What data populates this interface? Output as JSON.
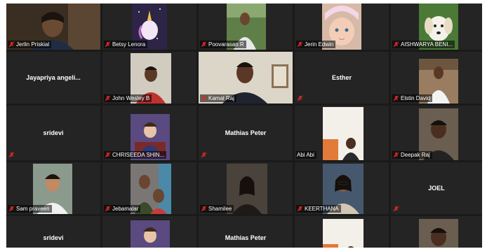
{
  "participants": [
    {
      "name": "Jerlin Priskial",
      "video": true,
      "bg": "#3d3226"
    },
    {
      "name": "Betsy Lenora",
      "video": true,
      "bg": "#2c2546"
    },
    {
      "name": "Poovarasan R",
      "video": true,
      "bg": "#4a6b3a"
    },
    {
      "name": "Jerin Edwin",
      "video": true,
      "bg": "#c9a99a"
    },
    {
      "name": "AISHWARYA BENI...",
      "video": true,
      "bg": "#3c5f2d"
    },
    {
      "name": "Jayapriya  angeli...",
      "video": false,
      "bg": "#242424"
    },
    {
      "name": "John Wesley B",
      "video": true,
      "bg": "#c8c1b5"
    },
    {
      "name": "Kamal Raj",
      "video": true,
      "bg": "#d9d3c4"
    },
    {
      "name": "Esther",
      "video": false,
      "bg": "#242424"
    },
    {
      "name": "Elstin David",
      "video": true,
      "bg": "#8a6f55"
    },
    {
      "name": "sridevi",
      "video": false,
      "bg": "#242424"
    },
    {
      "name": "CHRISEEDA SHIN...",
      "video": true,
      "bg": "#4a3b6b"
    },
    {
      "name": "Mathias Peter",
      "video": false,
      "bg": "#242424"
    },
    {
      "name": "Abi Abi",
      "video": true,
      "bg": "#f0ece6"
    },
    {
      "name": "Deepak Raj",
      "video": true,
      "bg": "#5a5045"
    },
    {
      "name": "Sam praveen",
      "video": true,
      "bg": "#7a8a7e"
    },
    {
      "name": "Jebamalar",
      "video": true,
      "bg": "#6d6a6a"
    },
    {
      "name": "Shamilee",
      "video": true,
      "bg": "#3b3733"
    },
    {
      "name": "KEERTHANA",
      "video": true,
      "bg": "#3c4d62"
    },
    {
      "name": "JOEL",
      "video": false,
      "bg": "#242424"
    },
    {
      "name": "sridevi",
      "video": false,
      "bg": "#242424"
    },
    {
      "name": "",
      "video": true,
      "bg": "#4a3b6b"
    },
    {
      "name": "Mathias Peter",
      "video": false,
      "bg": "#242424"
    },
    {
      "name": "",
      "video": true,
      "bg": "#f0ece6"
    },
    {
      "name": "",
      "video": true,
      "bg": "#5a5045"
    }
  ],
  "colors": {
    "mic_muted": "#e02828",
    "tile": "#242424",
    "gallery_bg": "#1a1a1a"
  }
}
